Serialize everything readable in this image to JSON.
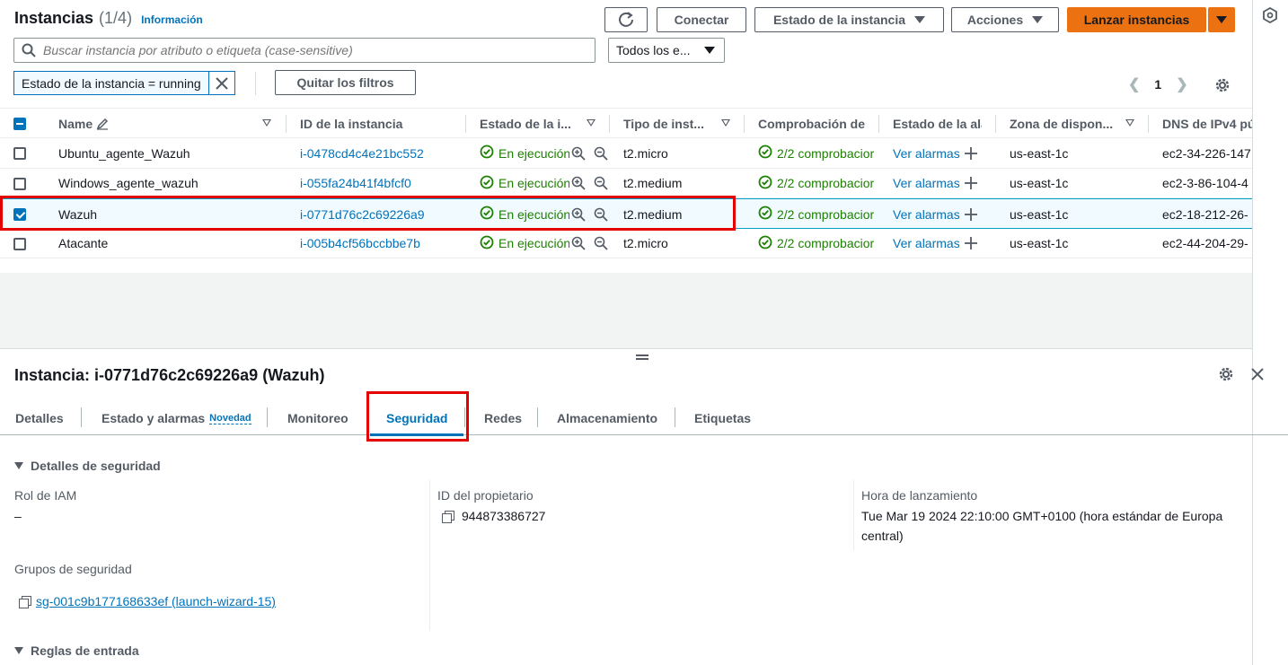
{
  "header": {
    "title": "Instancias",
    "count": "(1/4)",
    "info_link": "Información",
    "refresh_icon": "refresh-icon",
    "connect_label": "Conectar",
    "instance_state_label": "Estado de la instancia",
    "actions_label": "Acciones",
    "launch_label": "Lanzar instancias"
  },
  "search": {
    "placeholder": "Buscar instancia por atributo o etiqueta (case-sensitive)",
    "select_value": "Todos los e..."
  },
  "filters": {
    "token": "Estado de la instancia = running",
    "clear_label": "Quitar los filtros"
  },
  "pagination": {
    "page": "1"
  },
  "table": {
    "columns": [
      "Name",
      "ID de la instancia",
      "Estado de la i...",
      "Tipo de inst...",
      "Comprobación de",
      "Estado de la ala",
      "Zona de dispon...",
      "DNS de IPv4 pú"
    ],
    "rows": [
      {
        "name": "Ubuntu_agente_Wazuh",
        "id": "i-0478cd4c4e21bc552",
        "state": "En ejecución",
        "type": "t2.micro",
        "check": "2/2 comprobacior",
        "alarm": "Ver alarmas",
        "zone": "us-east-1c",
        "dns": "ec2-34-226-147",
        "selected": false
      },
      {
        "name": "Windows_agente_wazuh",
        "id": "i-055fa24b41f4bfcf0",
        "state": "En ejecución",
        "type": "t2.medium",
        "check": "2/2 comprobacior",
        "alarm": "Ver alarmas",
        "zone": "us-east-1c",
        "dns": "ec2-3-86-104-4",
        "selected": false
      },
      {
        "name": "Wazuh",
        "id": "i-0771d76c2c69226a9",
        "state": "En ejecución",
        "type": "t2.medium",
        "check": "2/2 comprobacior",
        "alarm": "Ver alarmas",
        "zone": "us-east-1c",
        "dns": "ec2-18-212-26-",
        "selected": true
      },
      {
        "name": "Atacante",
        "id": "i-005b4cf56bccbbe7b",
        "state": "En ejecución",
        "type": "t2.micro",
        "check": "2/2 comprobacior",
        "alarm": "Ver alarmas",
        "zone": "us-east-1c",
        "dns": "ec2-44-204-29-",
        "selected": false
      }
    ]
  },
  "detail": {
    "title": "Instancia: i-0771d76c2c69226a9 (Wazuh)",
    "tabs": [
      {
        "label": "Detalles"
      },
      {
        "label": "Estado y alarmas",
        "badge": "Novedad"
      },
      {
        "label": "Monitoreo"
      },
      {
        "label": "Seguridad",
        "active": true
      },
      {
        "label": "Redes"
      },
      {
        "label": "Almacenamiento"
      },
      {
        "label": "Etiquetas"
      }
    ],
    "security": {
      "section_title": "Detalles de seguridad",
      "iam_label": "Rol de IAM",
      "iam_value": "–",
      "owner_label": "ID del propietario",
      "owner_value": "944873386727",
      "launch_label": "Hora de lanzamiento",
      "launch_value": "Tue Mar 19 2024 22:10:00 GMT+0100 (hora estándar de Europa central)",
      "sg_label": "Grupos de seguridad",
      "sg_value": "sg-001c9b177168633ef (launch-wizard-15)",
      "inbound_title": "Reglas de entrada"
    }
  },
  "colors": {
    "primary": "#ec7211",
    "link": "#0073bb",
    "success": "#1d8102",
    "highlight": "#e50000"
  }
}
